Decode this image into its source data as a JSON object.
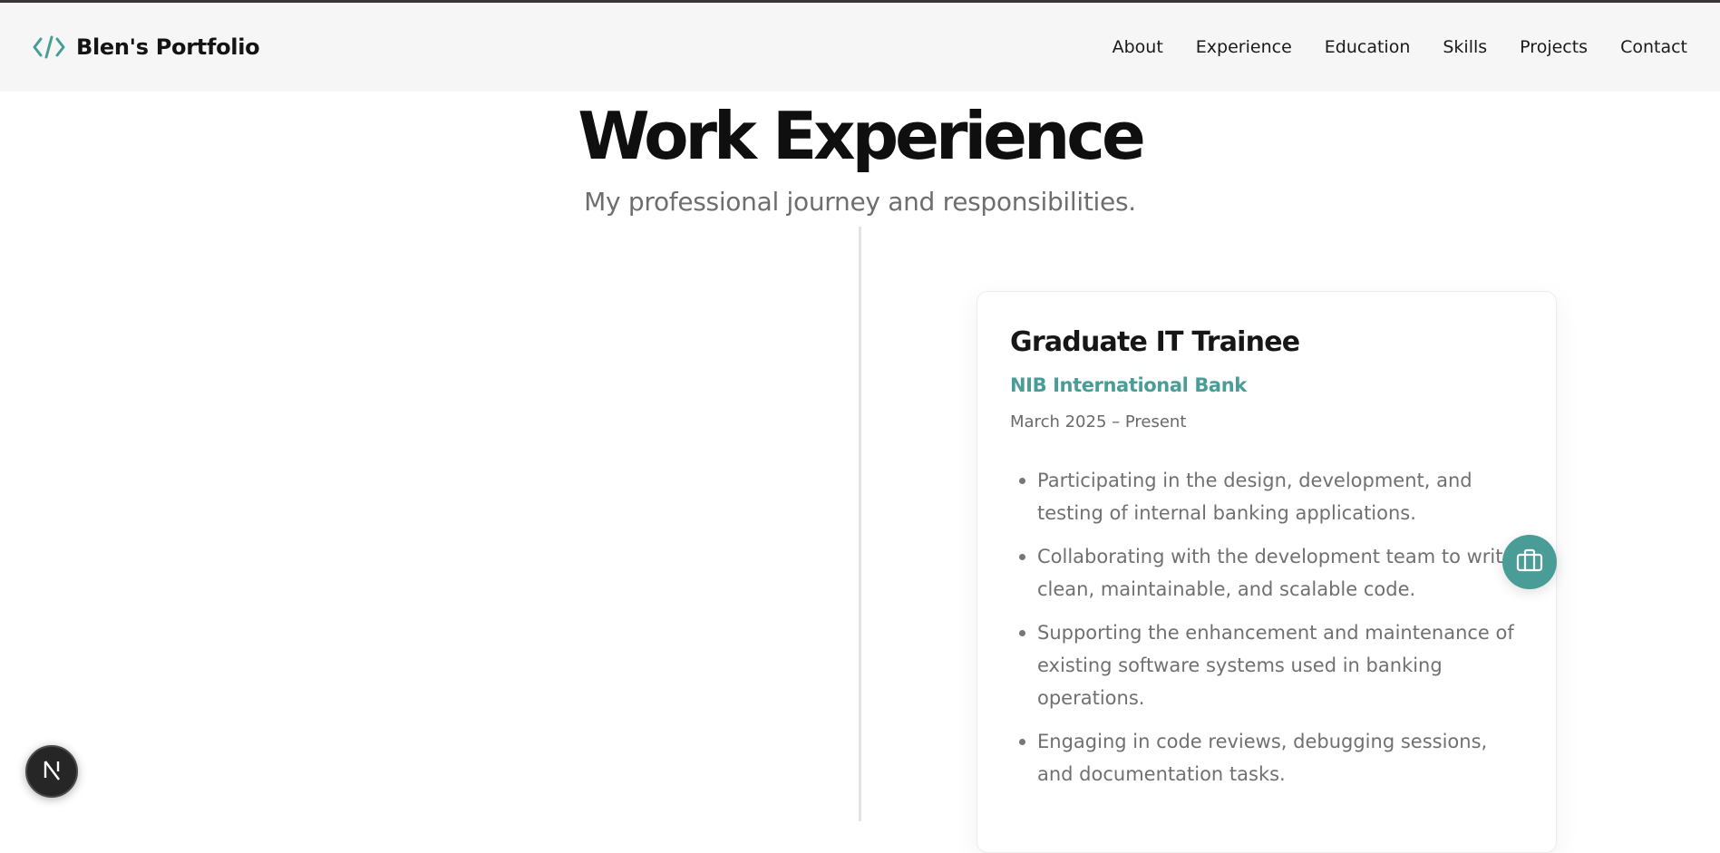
{
  "brand": {
    "icon": "code-icon",
    "title": "Blen's Portfolio"
  },
  "nav": [
    "About",
    "Experience",
    "Education",
    "Skills",
    "Projects",
    "Contact"
  ],
  "section": {
    "title": "Work Experience",
    "subtitle": "My professional journey and responsibilities."
  },
  "experience": [
    {
      "role": "Graduate IT Trainee",
      "company": "NIB International Bank",
      "dates": "March 2025 – Present",
      "bullets": [
        "Participating in the design, development, and testing of internal banking applications.",
        "Collaborating with the development team to write clean, maintainable, and scalable code.",
        "Supporting the enhancement and maintenance of existing software systems used in banking operations.",
        "Engaging in code reviews, debugging sessions, and documentation tasks."
      ],
      "badge_icon": "briefcase-icon"
    }
  ],
  "floating": {
    "icon": "nextjs-logo",
    "label": "N"
  },
  "colors": {
    "accent": "#4a9d97",
    "nav_bg": "#f6f6f6",
    "text_dark": "#141414",
    "text_muted": "#707070"
  }
}
